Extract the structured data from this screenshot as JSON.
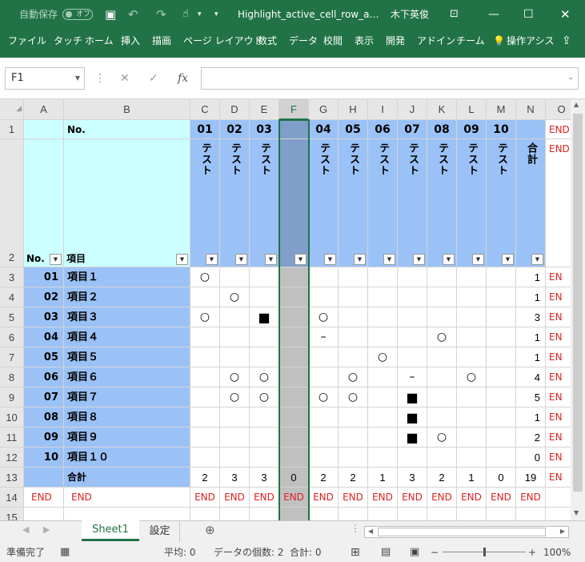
{
  "title_bar": {
    "autosave_label": "自動保存",
    "autosave_state": "オフ",
    "filename": "Highlight_active_cell_row_a…",
    "user": "木下英俊"
  },
  "ribbon_tabs": [
    "ファイル",
    "タッチ",
    "ホーム",
    "挿入",
    "描画",
    "ページ レイアウト",
    "数式",
    "データ",
    "校閲",
    "表示",
    "開発",
    "アドイン",
    "チーム",
    "操作アシス"
  ],
  "formula": {
    "name_box": "F1",
    "fx": "fx",
    "value": ""
  },
  "columns": [
    "A",
    "B",
    "C",
    "D",
    "E",
    "F",
    "G",
    "H",
    "I",
    "J",
    "K",
    "L",
    "M",
    "N",
    "O"
  ],
  "selected_column": "F",
  "rows": {
    "row1": {
      "label": "1",
      "b": "No.",
      "codes": [
        "01",
        "02",
        "03",
        "",
        "04",
        "05",
        "06",
        "07",
        "08",
        "09",
        "10",
        ""
      ],
      "o": "END"
    },
    "row2": {
      "label": "2",
      "a": "No.",
      "b": "項目",
      "tests": [
        "テスト",
        "テスト",
        "テスト",
        "",
        "テスト",
        "テスト",
        "テスト",
        "テスト",
        "テスト",
        "テスト",
        "テスト",
        "合計"
      ],
      "o": "END"
    },
    "data": [
      {
        "label": "3",
        "no": "01",
        "item": "項目１",
        "marks": [
          "○",
          "",
          "",
          "",
          "",
          "",
          "",
          "",
          "",
          "",
          "",
          ""
        ],
        "total": "1",
        "o": "EN"
      },
      {
        "label": "4",
        "no": "02",
        "item": "項目２",
        "marks": [
          "",
          "○",
          "",
          "",
          "",
          "",
          "",
          "",
          "",
          "",
          "",
          ""
        ],
        "total": "1",
        "o": "EN"
      },
      {
        "label": "5",
        "no": "03",
        "item": "項目３",
        "marks": [
          "○",
          "",
          "■",
          "",
          "○",
          "",
          "",
          "",
          "",
          "",
          "",
          ""
        ],
        "total": "3",
        "o": "EN"
      },
      {
        "label": "6",
        "no": "04",
        "item": "項目４",
        "marks": [
          "",
          "",
          "",
          "",
          "–",
          "",
          "",
          "",
          "○",
          "",
          "",
          ""
        ],
        "total": "1",
        "o": "EN"
      },
      {
        "label": "7",
        "no": "05",
        "item": "項目５",
        "marks": [
          "",
          "",
          "",
          "",
          "",
          "",
          "○",
          "",
          "",
          "",
          "",
          ""
        ],
        "total": "1",
        "o": "EN"
      },
      {
        "label": "8",
        "no": "06",
        "item": "項目６",
        "marks": [
          "",
          "○",
          "○",
          "",
          "",
          "○",
          "",
          "–",
          "",
          "○",
          "",
          ""
        ],
        "total": "4",
        "o": "EN"
      },
      {
        "label": "9",
        "no": "07",
        "item": "項目７",
        "marks": [
          "",
          "○",
          "○",
          "",
          "○",
          "○",
          "",
          "■",
          "",
          "",
          "",
          ""
        ],
        "total": "5",
        "o": "EN"
      },
      {
        "label": "10",
        "no": "08",
        "item": "項目８",
        "marks": [
          "",
          "",
          "",
          "",
          "",
          "",
          "",
          "■",
          "",
          "",
          "",
          ""
        ],
        "total": "1",
        "o": "EN"
      },
      {
        "label": "11",
        "no": "09",
        "item": "項目９",
        "marks": [
          "",
          "",
          "",
          "",
          "",
          "",
          "",
          "■",
          "○",
          "",
          "",
          ""
        ],
        "total": "2",
        "o": "EN"
      },
      {
        "label": "12",
        "no": "10",
        "item": "項目１０",
        "marks": [
          "",
          "",
          "",
          "",
          "",
          "",
          "",
          "",
          "",
          "",
          "",
          ""
        ],
        "total": "0",
        "o": "EN"
      }
    ],
    "row13": {
      "label": "13",
      "b": "合計",
      "vals": [
        "2",
        "3",
        "3",
        "0",
        "2",
        "2",
        "1",
        "3",
        "2",
        "1",
        "0",
        "19"
      ],
      "o": "EN"
    },
    "row14": {
      "label": "14",
      "cells": [
        "END",
        "END",
        "END",
        "END",
        "END",
        "END",
        "END",
        "END",
        "END",
        "END",
        "END",
        "END",
        "END",
        "END"
      ]
    },
    "row15": {
      "label": "15"
    }
  },
  "sheet_tabs": [
    "Sheet1",
    "設定"
  ],
  "status": {
    "ready": "準備完了",
    "avg": "平均: 0",
    "count": "データの個数: 2",
    "sum": "合計: 0",
    "zoom": "100%"
  }
}
